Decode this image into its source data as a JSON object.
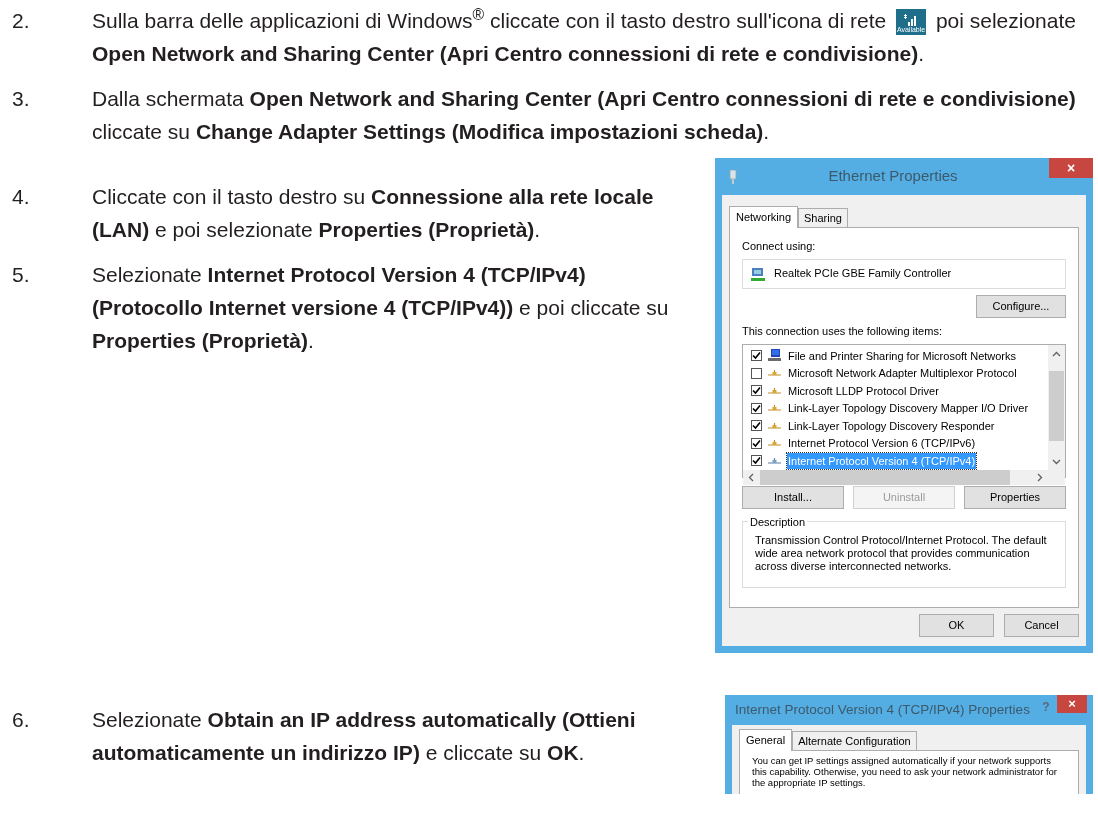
{
  "steps_top": [
    {
      "number": "2.",
      "parts": [
        {
          "kind": "text",
          "text": "Sulla barra delle applicazioni di Windows$^{®}$ cliccate con il tasto destro sull'icona di rete"
        },
        {
          "kind": "network_icon",
          "label": "Available"
        },
        {
          "kind": "text",
          "text": "poi selezionate **Open Network and Sharing Center (Apri Centro connessioni di rete e condivisione)**."
        }
      ]
    },
    {
      "number": "3.",
      "parts": [
        {
          "kind": "text",
          "text": "Dalla schermata **Open Network and Sharing Center (Apri Centro connessioni di rete e condivisione)** cliccate su **Change Adapter Settings (Modifica impostazioni scheda)**."
        }
      ]
    }
  ],
  "steps_middle": [
    {
      "number": "4.",
      "parts": [
        {
          "kind": "text",
          "text": "Cliccate con il tasto destro su **Connessione alla rete locale (LAN)** e poi selezionate **Properties (Proprietà)**."
        }
      ]
    },
    {
      "number": "5.",
      "parts": [
        {
          "kind": "text",
          "text": "Selezionate **Internet Protocol Version 4 (TCP/IPv4) (Protocollo Internet versione 4 (TCP/IPv4))** e poi cliccate su **Properties (Proprietà)**."
        }
      ]
    }
  ],
  "ethernet_dialog": {
    "title": "Ethernet Properties",
    "close": "×",
    "tabs": [
      {
        "label": "Networking",
        "selected": true
      },
      {
        "label": "Sharing",
        "selected": false
      }
    ],
    "connect_using_label": "Connect using:",
    "adapter": "Realtek PCIe GBE Family Controller",
    "configure_button": "Configure...",
    "items_label": "This connection uses the following items:",
    "items": [
      {
        "kind": "computer",
        "label": "File and Printer Sharing for Microsoft Networks",
        "checked": true,
        "selected": false
      },
      {
        "kind": "protocol",
        "label": "Microsoft Network Adapter Multiplexor Protocol",
        "checked": false,
        "selected": false
      },
      {
        "kind": "protocol",
        "label": "Microsoft LLDP Protocol Driver",
        "checked": true,
        "selected": false
      },
      {
        "kind": "protocol",
        "label": "Link-Layer Topology Discovery Mapper I/O Driver",
        "checked": true,
        "selected": false
      },
      {
        "kind": "protocol",
        "label": "Link-Layer Topology Discovery Responder",
        "checked": true,
        "selected": false
      },
      {
        "kind": "protocol",
        "label": "Internet Protocol Version 6 (TCP/IPv6)",
        "checked": true,
        "selected": false
      },
      {
        "kind": "protocol",
        "label": "Internet Protocol Version 4 (TCP/IPv4)",
        "checked": true,
        "selected": true
      }
    ],
    "item_buttons": [
      {
        "label": "Install...",
        "disabled": false
      },
      {
        "label": "Uninstall",
        "disabled": true
      },
      {
        "label": "Properties",
        "disabled": false
      }
    ],
    "description_title": "Description",
    "description": "Transmission Control Protocol/Internet Protocol. The default wide area network protocol that provides communication across diverse interconnected networks.",
    "footer_buttons": [
      "OK",
      "Cancel"
    ]
  },
  "steps_bottom": [
    {
      "number": "6.",
      "parts": [
        {
          "kind": "text",
          "text": "Selezionate **Obtain an IP address automatically (Ottieni automaticamente un indirizzo IP)** e cliccate su **OK**."
        }
      ]
    }
  ],
  "ipv4_dialog": {
    "title": "Internet Protocol Version 4 (TCP/IPv4) Properties",
    "help": "?",
    "close": "×",
    "tabs": [
      {
        "label": "General",
        "selected": true
      },
      {
        "label": "Alternate Configuration",
        "selected": false
      }
    ],
    "intro": "You can get IP settings assigned automatically if your network supports this capability. Otherwise, you need to ask your network administrator for the appropriate IP settings."
  }
}
